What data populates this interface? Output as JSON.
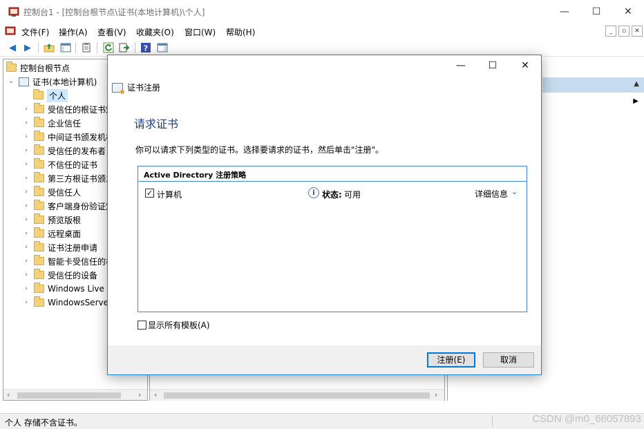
{
  "window": {
    "title": "控制台1 - [控制台根节点\\证书(本地计算机)\\个人]",
    "minimize": "—",
    "maximize": "☐",
    "close": "✕"
  },
  "menubar": {
    "items": [
      "文件(F)",
      "操作(A)",
      "查看(V)",
      "收藏夹(O)",
      "窗口(W)",
      "帮助(H)"
    ]
  },
  "toolbar": {
    "icons": [
      "back-icon",
      "forward-icon",
      "up-folder-icon",
      "show-hide-tree-icon",
      "properties-icon",
      "refresh-icon",
      "export-list-icon",
      "help-icon",
      "action-pane-icon"
    ]
  },
  "tree": {
    "root": "控制台根节点",
    "certs": "证书(本地计算机)",
    "selected": "个人",
    "children": [
      "受信任的根证书颁",
      "企业信任",
      "中间证书颁发机构",
      "受信任的发布者",
      "不信任的证书",
      "第三方根证书颁发",
      "受信任人",
      "客户端身份验证颁",
      "预览版根",
      "远程桌面",
      "证书注册申请",
      "智能卡受信任的根",
      "受信任的设备",
      "Windows Live I",
      "WindowsServe"
    ]
  },
  "statusbar": {
    "text": "个人 存储不含证书。",
    "watermark": "CSDN @m0_66057893"
  },
  "dialog": {
    "header": "证书注册",
    "heading": "请求证书",
    "description": "你可以请求下列类型的证书。选择要请求的证书，然后单击\"注册\"。",
    "policy_title": "Active Directory 注册策略",
    "row": {
      "checked": true,
      "label": "计算机",
      "status_label": "状态:",
      "status_value": "可用",
      "details": "详细信息"
    },
    "show_all": "显示所有模板(A)",
    "enroll_button": "注册(E)",
    "cancel_button": "取消"
  },
  "colors": {
    "accent": "#1883d7",
    "heading": "#1b3f8f",
    "selection": "#cce8ff",
    "action_header": "#c6dbee"
  }
}
